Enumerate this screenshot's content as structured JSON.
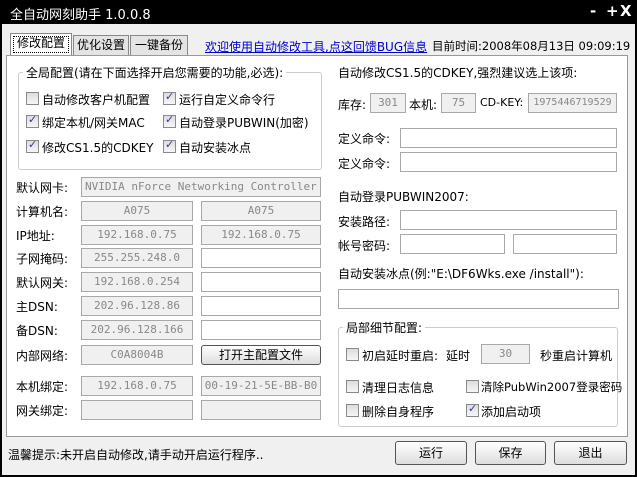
{
  "window": {
    "title": "全自动网刻助手 1.0.0.8",
    "minimize": "-",
    "maximize": "+",
    "close": "X"
  },
  "tabs": [
    {
      "label": "修改配置",
      "selected": true
    },
    {
      "label": "优化设置"
    },
    {
      "label": "一键备份"
    }
  ],
  "feedback_link": "欢迎使用自动修改工具,点这回馈BUG信息",
  "current_time": "目前时间:2008年08月13日 09:09:19",
  "global": {
    "legend": "全局配置(请在下面选择开启您需要的功能,必选):",
    "options": [
      {
        "label": "自动修改客户机配置",
        "checked": false
      },
      {
        "label": "运行自定义命令行",
        "checked": true
      },
      {
        "label": "绑定本机/网关MAC",
        "checked": true
      },
      {
        "label": "自动登录PUBWIN(加密)",
        "checked": true
      },
      {
        "label": "修改CS1.5的CDKEY",
        "checked": true
      },
      {
        "label": "自动安装冰点",
        "checked": true
      }
    ]
  },
  "network": {
    "nic_label": "默认网卡:",
    "nic_value": "NVIDIA nForce Networking Controller - D",
    "rows": [
      {
        "label": "计算机名:",
        "v1": "A075",
        "v2": "A075"
      },
      {
        "label": "IP地址:",
        "v1": "192.168.0.75",
        "v2": "192.168.0.75"
      },
      {
        "label": "子网掩码:",
        "v1": "255.255.248.0",
        "v2": ""
      },
      {
        "label": "默认网关:",
        "v1": "192.168.0.254",
        "v2": ""
      },
      {
        "label": "主DSN:",
        "v1": "202.96.128.86",
        "v2": ""
      },
      {
        "label": "备DSN:",
        "v1": "202.96.128.166",
        "v2": ""
      }
    ],
    "internal_label": "内部网络:",
    "internal_value": "C0A8004B",
    "open_config_button": "打开主配置文件",
    "bind_local_label": "本机绑定:",
    "bind_local_ip": "192.168.0.75",
    "bind_local_mac": "00-19-21-5E-BB-B0",
    "bind_gw_label": "网关绑定:",
    "bind_gw_ip": "",
    "bind_gw_mac": ""
  },
  "cdkey": {
    "header": "自动修改CS1.5的CDKEY,强烈建议选上该项:",
    "stock_label": "库存:",
    "stock": "301",
    "local_label": "本机:",
    "local": "75",
    "key_label": "CD-KEY:",
    "key": "1975446719529"
  },
  "commands": [
    {
      "label": "定义命令:",
      "value": ""
    },
    {
      "label": "定义命令:",
      "value": ""
    }
  ],
  "pubwin": {
    "header": "自动登录PUBWIN2007:",
    "path_label": "安装路径:",
    "path": "",
    "account_label": "帐号密码:",
    "account": "",
    "password": ""
  },
  "freeze": {
    "label": "自动安装冰点(例:\"E:\\DF6Wks.exe /install\"):",
    "value": ""
  },
  "local": {
    "legend": "局部细节配置:",
    "delay_label": "初启延时重启:",
    "delay_checked": false,
    "delay_prefix": "延时",
    "delay_value": "30",
    "delay_suffix": "秒重启计算机",
    "options": [
      {
        "label": "清理日志信息",
        "checked": false
      },
      {
        "label": "清除PubWin2007登录密码",
        "checked": false
      },
      {
        "label": "删除自身程序",
        "checked": false
      },
      {
        "label": "添加启动项",
        "checked": true
      }
    ]
  },
  "buttons": {
    "run": "运行",
    "save": "保存",
    "exit": "退出"
  },
  "status": "温馨提示:未开启自动修改,请手动开启运行程序.."
}
